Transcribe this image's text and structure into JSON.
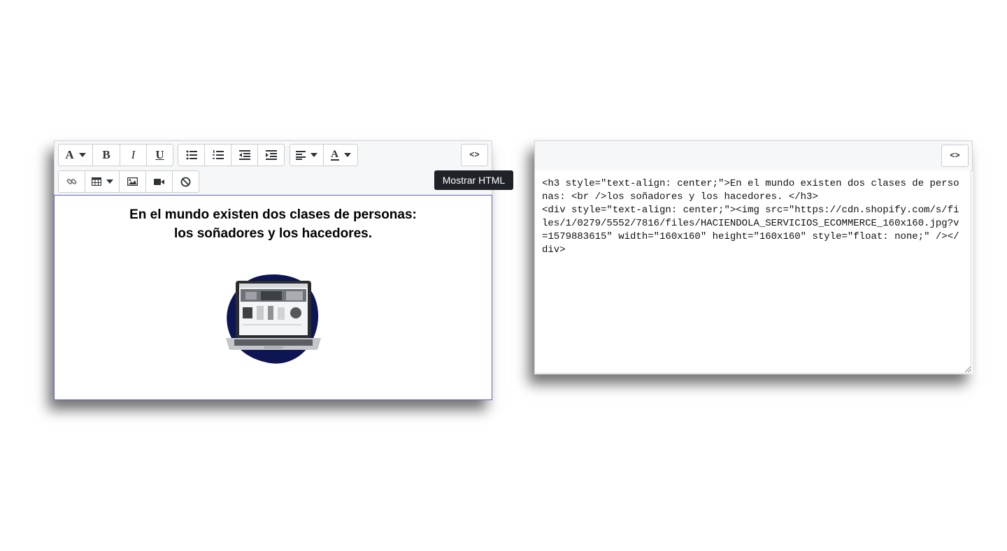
{
  "left_editor": {
    "toolbar": {
      "font_glyph": "A",
      "bold_glyph": "B",
      "italic_glyph": "I",
      "underline_glyph": "U",
      "color_glyph": "A",
      "code_view_label": "<>"
    },
    "content": {
      "heading_line1": "En el mundo existen dos clases de personas:",
      "heading_line2": "los soñadores y los hacedores."
    }
  },
  "tooltip": {
    "text": "Mostrar HTML"
  },
  "right_editor": {
    "toolbar": {
      "code_view_label": "<>"
    },
    "code": "<h3 style=\"text-align: center;\">En el mundo existen dos clases de personas: <br />los soñadores y los hacedores. </h3>\n<div style=\"text-align: center;\"><img src=\"https://cdn.shopify.com/s/files/1/0279/5552/7816/files/HACIENDOLA_SERVICIOS_ECOMMERCE_160x160.jpg?v=1579883615\" width=\"160x160\" height=\"160x160\" style=\"float: none;\" /></div>"
  },
  "colors": {
    "accent_border": "#5a64c8",
    "toolbar_bg": "#f6f7f9",
    "tooltip_bg": "#1f2328",
    "blob_navy": "#0d1552"
  },
  "icons": [
    "font-icon",
    "bold-icon",
    "italic-icon",
    "underline-icon",
    "bullet-list-icon",
    "numbered-list-icon",
    "outdent-icon",
    "indent-icon",
    "align-left-icon",
    "text-color-icon",
    "code-view-icon",
    "link-icon",
    "table-icon",
    "image-icon",
    "video-icon",
    "clear-format-icon"
  ]
}
